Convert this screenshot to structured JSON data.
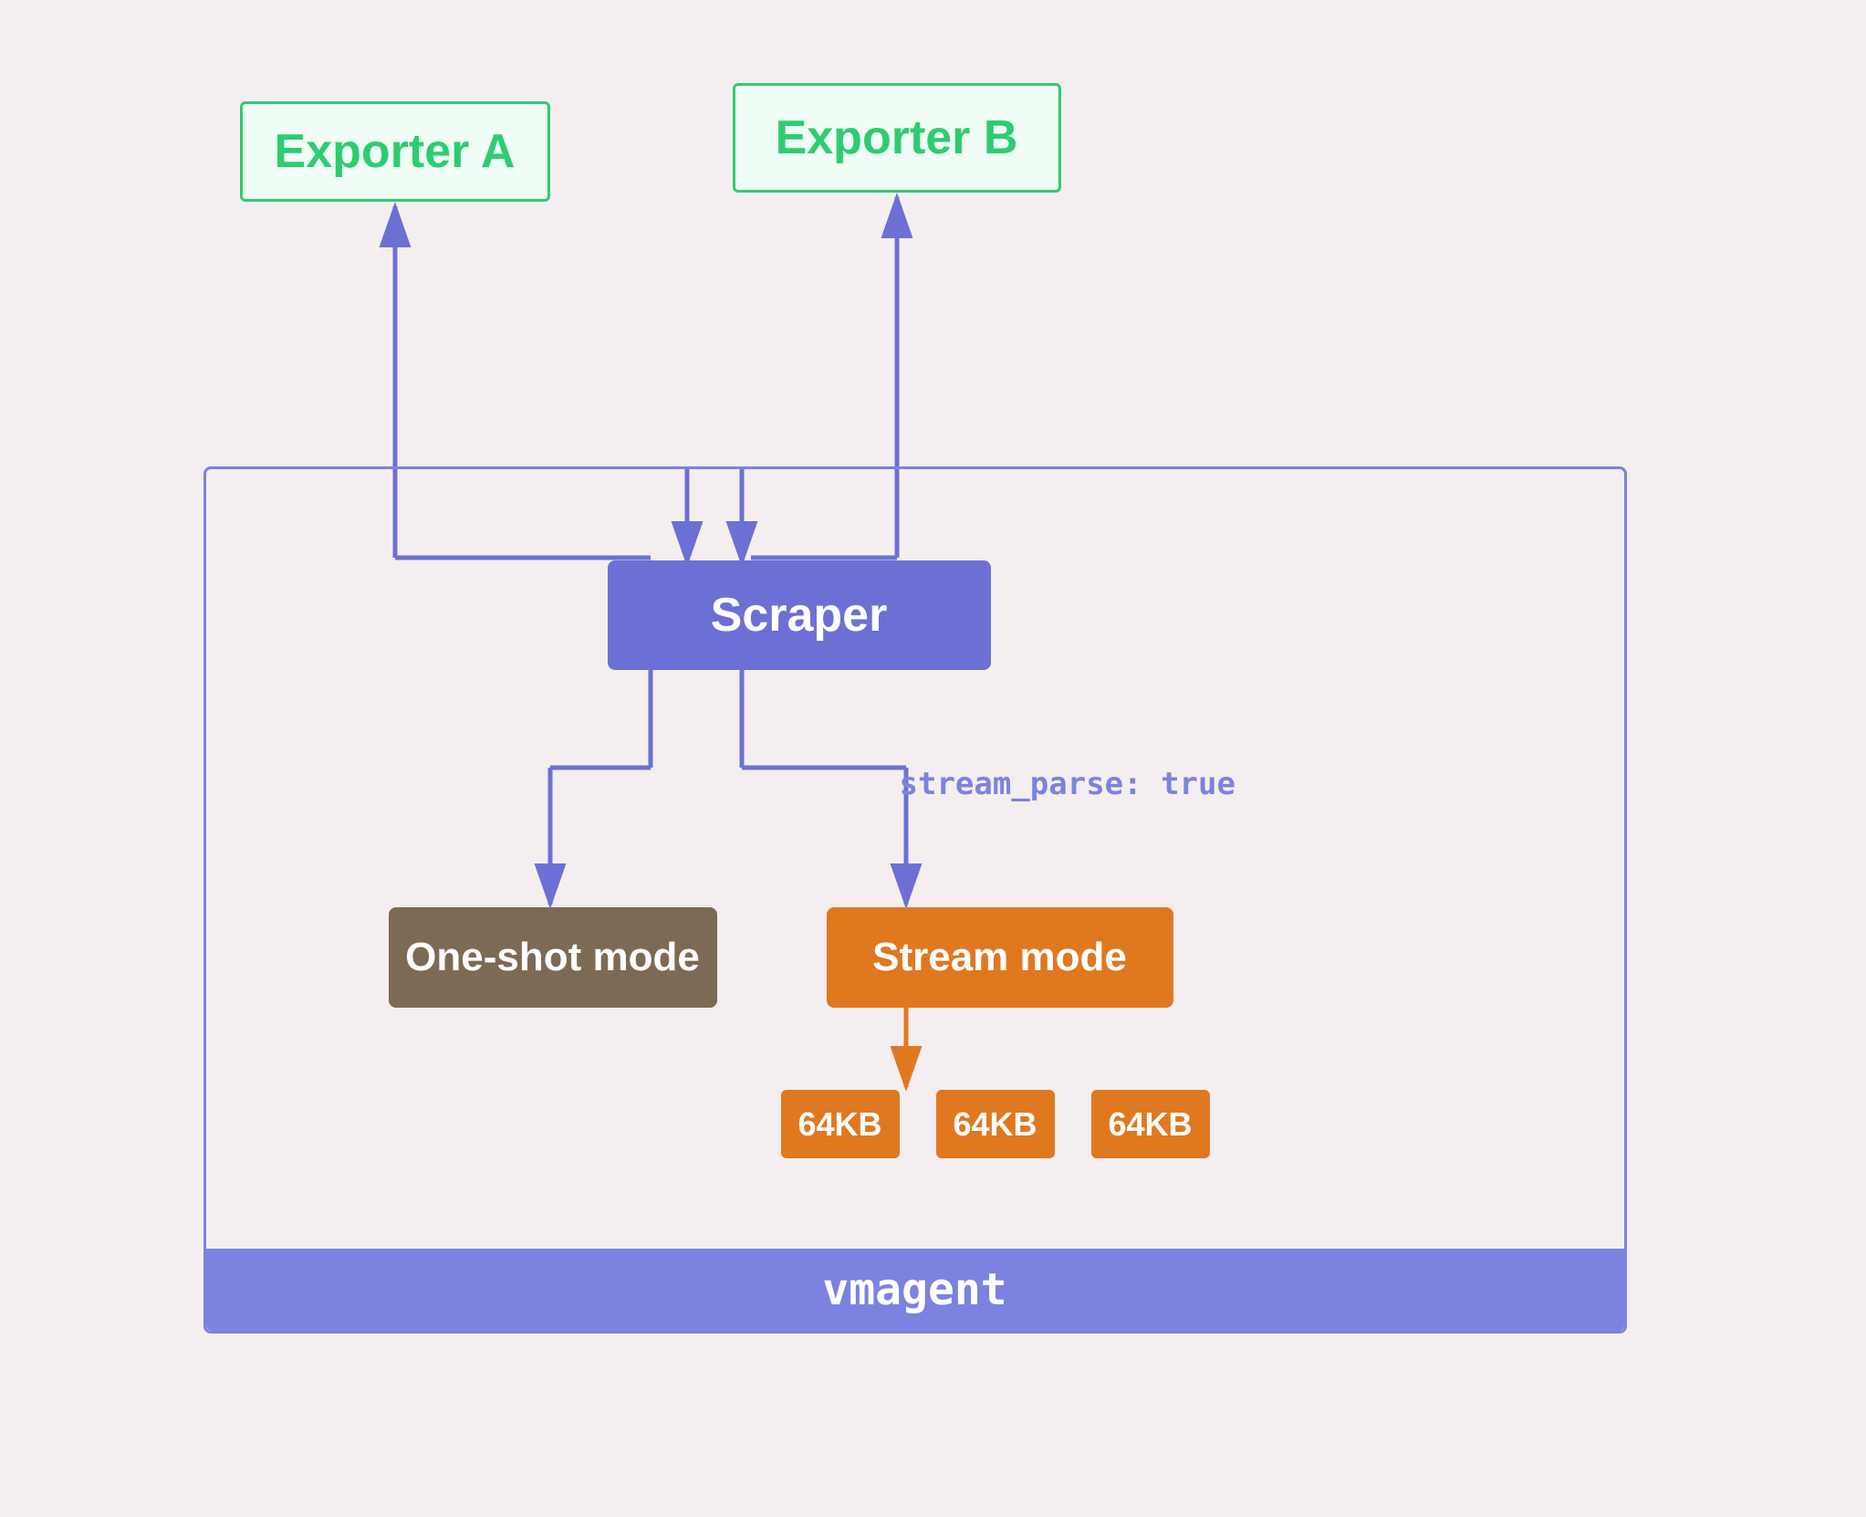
{
  "exporters": {
    "a": {
      "label": "Exporter A"
    },
    "b": {
      "label": "Exporter B"
    }
  },
  "scraper": {
    "label": "Scraper"
  },
  "modes": {
    "oneshot": {
      "label": "One-shot mode"
    },
    "stream": {
      "label": "Stream mode"
    }
  },
  "chunks": {
    "c1": "64KB",
    "c2": "64KB",
    "c3": "64KB"
  },
  "annotation": {
    "stream_parse": "stream_parse: true"
  },
  "vmagent": {
    "label": "vmagent"
  },
  "colors": {
    "green": "#2ecc71",
    "blue_arrow": "#6c70d4",
    "orange": "#e07820"
  }
}
